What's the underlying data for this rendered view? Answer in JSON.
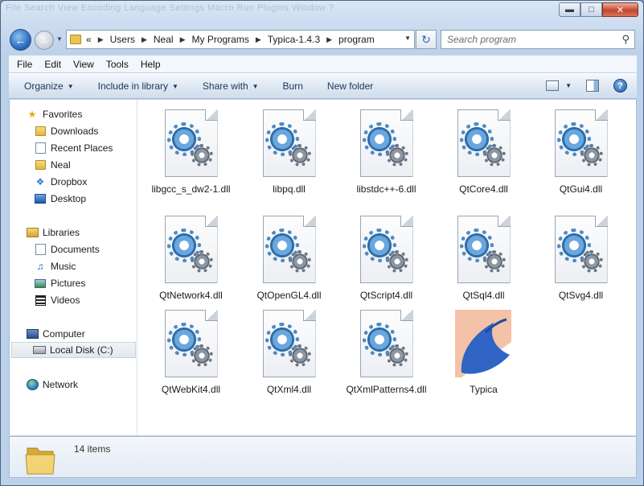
{
  "window": {
    "ghost_menu": "File  Search  View  Encoding  Language  Settings  Macro  Run  Plugins  Window  ?",
    "minimize": "▬",
    "maximize": "□",
    "close": "✕"
  },
  "address": {
    "prefix": "«",
    "crumbs": [
      "Users",
      "Neal",
      "My Programs",
      "Typica-1.4.3",
      "program"
    ]
  },
  "search": {
    "placeholder": "Search program"
  },
  "menubar": [
    "File",
    "Edit",
    "View",
    "Tools",
    "Help"
  ],
  "commands": [
    "Organize",
    "Include in library",
    "Share with",
    "Burn",
    "New folder"
  ],
  "nav": {
    "favorites": {
      "label": "Favorites",
      "items": [
        "Downloads",
        "Recent Places",
        "Neal",
        "Dropbox",
        "Desktop"
      ]
    },
    "libraries": {
      "label": "Libraries",
      "items": [
        "Documents",
        "Music",
        "Pictures",
        "Videos"
      ]
    },
    "computer": {
      "label": "Computer",
      "items": [
        "Local Disk (C:)"
      ]
    },
    "network": {
      "label": "Network"
    }
  },
  "files": [
    {
      "name": "libgcc_s_dw2-1.dll",
      "icon": "dll-gear-icon"
    },
    {
      "name": "libpq.dll",
      "icon": "dll-gear-icon"
    },
    {
      "name": "libstdc++-6.dll",
      "icon": "dll-gear-icon"
    },
    {
      "name": "QtCore4.dll",
      "icon": "dll-gear-icon"
    },
    {
      "name": "QtGui4.dll",
      "icon": "dll-gear-icon"
    },
    {
      "name": "QtNetwork4.dll",
      "icon": "dll-gear-icon"
    },
    {
      "name": "QtOpenGL4.dll",
      "icon": "dll-gear-icon"
    },
    {
      "name": "QtScript4.dll",
      "icon": "dll-gear-icon"
    },
    {
      "name": "QtSql4.dll",
      "icon": "dll-gear-icon"
    },
    {
      "name": "QtSvg4.dll",
      "icon": "dll-gear-icon"
    },
    {
      "name": "QtWebKit4.dll",
      "icon": "dll-gear-icon"
    },
    {
      "name": "QtXml4.dll",
      "icon": "dll-gear-icon"
    },
    {
      "name": "QtXmlPatterns4.dll",
      "icon": "dll-gear-icon"
    },
    {
      "name": "Typica",
      "icon": "typica-app-icon"
    }
  ],
  "details": {
    "items_count": "14 items"
  },
  "colors": {
    "accent": "#1e3555",
    "window_frame": "#bcd1ea",
    "selection": "#e3e8ee"
  }
}
